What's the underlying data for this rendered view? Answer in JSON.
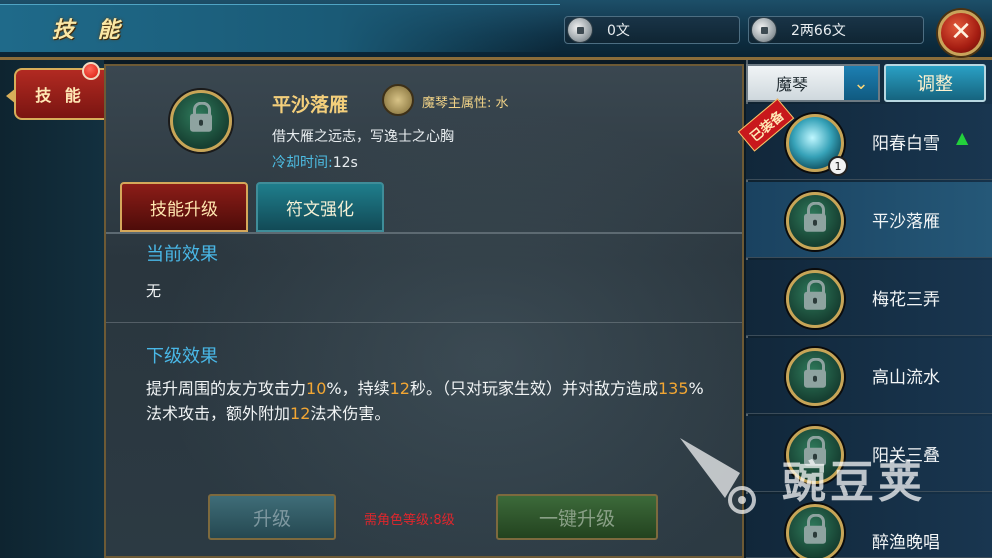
{
  "header": {
    "title": "技 能",
    "currency_copper": "0文",
    "currency_silver": "2两66文",
    "close_glyph": "✕"
  },
  "left_nav": {
    "tab_label": "技 能"
  },
  "skill": {
    "name": "平沙落雁",
    "attribute": "魔琴主属性: 水",
    "description": "借大雁之远志，写逸士之心胸",
    "cooldown_label": "冷却时间:",
    "cooldown_value": "12s"
  },
  "tabs": {
    "upgrade": "技能升级",
    "rune": "符文强化"
  },
  "effects": {
    "current_title": "当前效果",
    "current_value": "无",
    "next_title": "下级效果",
    "next_text": {
      "p1": "提升周围的友方攻击力",
      "v1": "10",
      "p2": "%，持续",
      "v2": "12",
      "p3": "秒。（只对玩家生效）并对敌方造成",
      "v3": "135",
      "p4": "%法术攻击，额外附加",
      "v4": "12",
      "p5": "法术伤害。"
    }
  },
  "actions": {
    "upgrade_label": "升级",
    "one_click_label": "一键升级",
    "requirement": "需角色等级:8级"
  },
  "right_panel": {
    "dropdown_value": "魔琴",
    "adjust_label": "调整",
    "equipped_badge": "已装备",
    "skills": [
      {
        "name": "阳春白雪",
        "level": "1"
      },
      {
        "name": "平沙落雁"
      },
      {
        "name": "梅花三弄"
      },
      {
        "name": "高山流水"
      },
      {
        "name": "阳关三叠"
      },
      {
        "name": "醉渔晚唱"
      }
    ]
  },
  "watermark": {
    "text": "豌豆荚"
  },
  "colors": {
    "accent_gold": "#f4cf7b",
    "label_blue": "#49b7e6",
    "highlight_orange": "#f2a633",
    "warning_red": "#e0262c"
  }
}
